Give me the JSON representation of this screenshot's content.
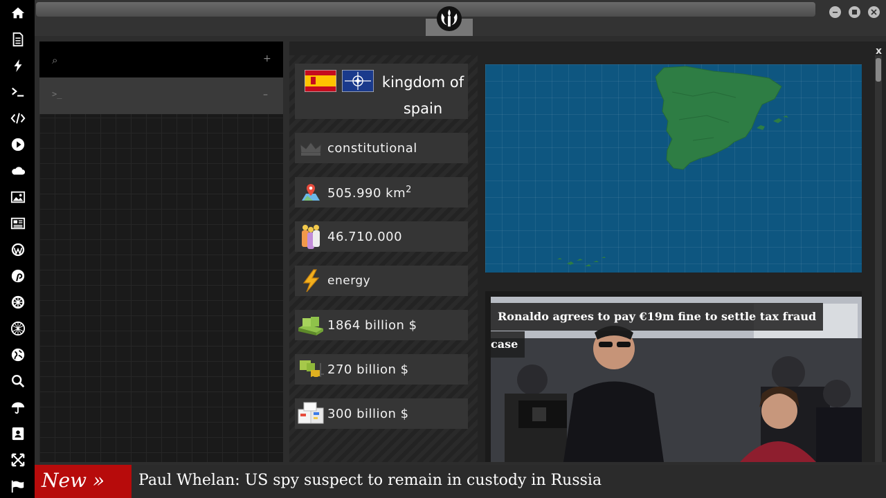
{
  "sidebar": {
    "icons": [
      "home-icon",
      "document-icon",
      "lightning-icon",
      "terminal-icon",
      "code-icon",
      "play-icon",
      "cloud-icon",
      "image-icon",
      "newspaper-icon",
      "wordpress-icon",
      "pinterest-icon",
      "galactic-empire-icon",
      "hexagon-globe-icon",
      "globe-icon",
      "search-icon",
      "umbrella-icon",
      "contact-card-icon",
      "expand-icon",
      "flag-icon"
    ]
  },
  "topbar": {
    "logo": "rebel-alliance-logo",
    "window_buttons": [
      "minimize-icon",
      "maximize-icon",
      "close-icon"
    ]
  },
  "leftpanel": {
    "search_glyph": "⌕",
    "add_glyph": "+",
    "prompt_glyph": ">_",
    "collapse_glyph": "–"
  },
  "country": {
    "title": "kingdom of spain",
    "flags": [
      "spain-flag-icon",
      "nato-flag-icon"
    ],
    "government": "constitutional",
    "area": "505.990 km",
    "area_sup": "2",
    "population": "46.710.000",
    "sector": "energy",
    "gdp": "1864 billion $",
    "exports": "270 billion $",
    "imports": "300 billion $"
  },
  "colors": {
    "ticker_label_bg": "#b70b0b",
    "map_sea": "#0e5680",
    "map_land": "#2e7d44"
  },
  "news": {
    "headline_line1": "Ronaldo agrees to pay €19m fine to settle tax fraud",
    "headline_line2": "case",
    "close": "x"
  },
  "ticker": {
    "label": "New »",
    "text": "Paul Whelan: US spy suspect to remain in custody in Russia"
  }
}
